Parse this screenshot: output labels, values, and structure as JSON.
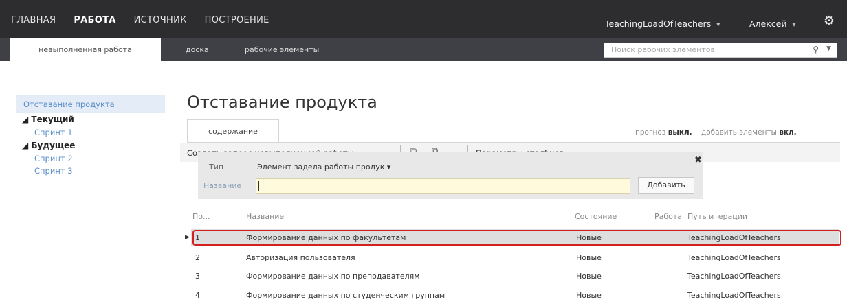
{
  "topnav": {
    "items": [
      "ГЛАВНАЯ",
      "РАБОТА",
      "ИСТОЧНИК",
      "ПОСТРОЕНИЕ"
    ],
    "active_index": 1,
    "project": "TeachingLoadOfTeachers",
    "user": "Алексей",
    "settings_icon": "gear-icon"
  },
  "subtabs": {
    "active": "невыполненная работа",
    "items": [
      "доска",
      "рабочие элементы"
    ],
    "search_placeholder": "Поиск рабочих элементов"
  },
  "sidebar": {
    "selected": "Отставание продукта",
    "current_header": "Текущий",
    "current_items": [
      "Спринт 1"
    ],
    "future_header": "Будущее",
    "future_items": [
      "Спринт 2",
      "Спринт 3"
    ]
  },
  "main": {
    "title": "Отставание продукта",
    "content_tab": "содержание",
    "forecast_label": "прогноз",
    "forecast_value": "выкл.",
    "add_items_label": "добавить элементы",
    "add_items_value": "вкл."
  },
  "toolbar": {
    "create_query": "Создать запрос невыполненной работы",
    "column_options": "Параметры столбцов"
  },
  "quick_add": {
    "type_label": "Тип",
    "type_value": "Элемент задела работы продук",
    "name_label": "Название",
    "add_button": "Добавить"
  },
  "grid": {
    "headers": [
      "По...",
      "Название",
      "Состояние",
      "Работа",
      "Путь итерации"
    ],
    "rows": [
      {
        "order": "1",
        "title": "Формирование данных по факультетам",
        "state": "Новые",
        "work": "",
        "iteration": "TeachingLoadOfTeachers"
      },
      {
        "order": "2",
        "title": "Авторизация пользователя",
        "state": "Новые",
        "work": "",
        "iteration": "TeachingLoadOfTeachers"
      },
      {
        "order": "3",
        "title": "Формирование данных по преподавателям",
        "state": "Новые",
        "work": "",
        "iteration": "TeachingLoadOfTeachers"
      },
      {
        "order": "4",
        "title": "Формирование данных по студенческим группам",
        "state": "Новые",
        "work": "",
        "iteration": "TeachingLoadOfTeachers"
      }
    ],
    "selected_row": 0
  }
}
